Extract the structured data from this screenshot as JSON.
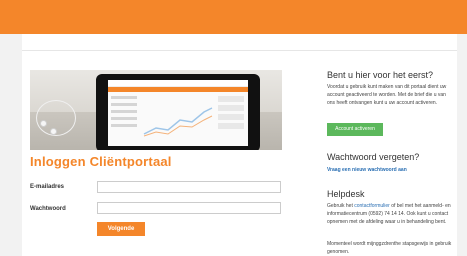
{
  "colors": {
    "brand": "#f4862a",
    "green": "#5cb85c",
    "link": "#2a6fb3"
  },
  "login": {
    "title": "Inloggen Cliëntportaal",
    "email_label": "E-mailadres",
    "password_label": "Wachtwoord",
    "email_value": "",
    "password_value": "",
    "submit_label": "Volgende"
  },
  "sidebar": {
    "first_time": {
      "heading": "Bent u hier voor het eerst?",
      "text": "Voordat u gebruik kunt maken van dit portaal dient uw account geactiveerd te worden. Met de brief die u van ons heeft ontvangen kunt u uw account activeren.",
      "button_label": "Account activeren"
    },
    "forgot": {
      "heading": "Wachtwoord vergeten?",
      "link_label": "Vraag een nieuw wachtwoord aan"
    },
    "helpdesk": {
      "heading": "Helpdesk",
      "text_before": "Gebruik het",
      "link_label": "contactformulier",
      "text_after": "of bel met het aanmeld- en informatiecentrum (0592) 74 14 14. Ook kunt u contact opnemen met de afdeling waar u in behandeling bent.",
      "note": "Momenteel wordt mijnggzdrenthe stapsgewijs in gebruik genomen."
    }
  }
}
